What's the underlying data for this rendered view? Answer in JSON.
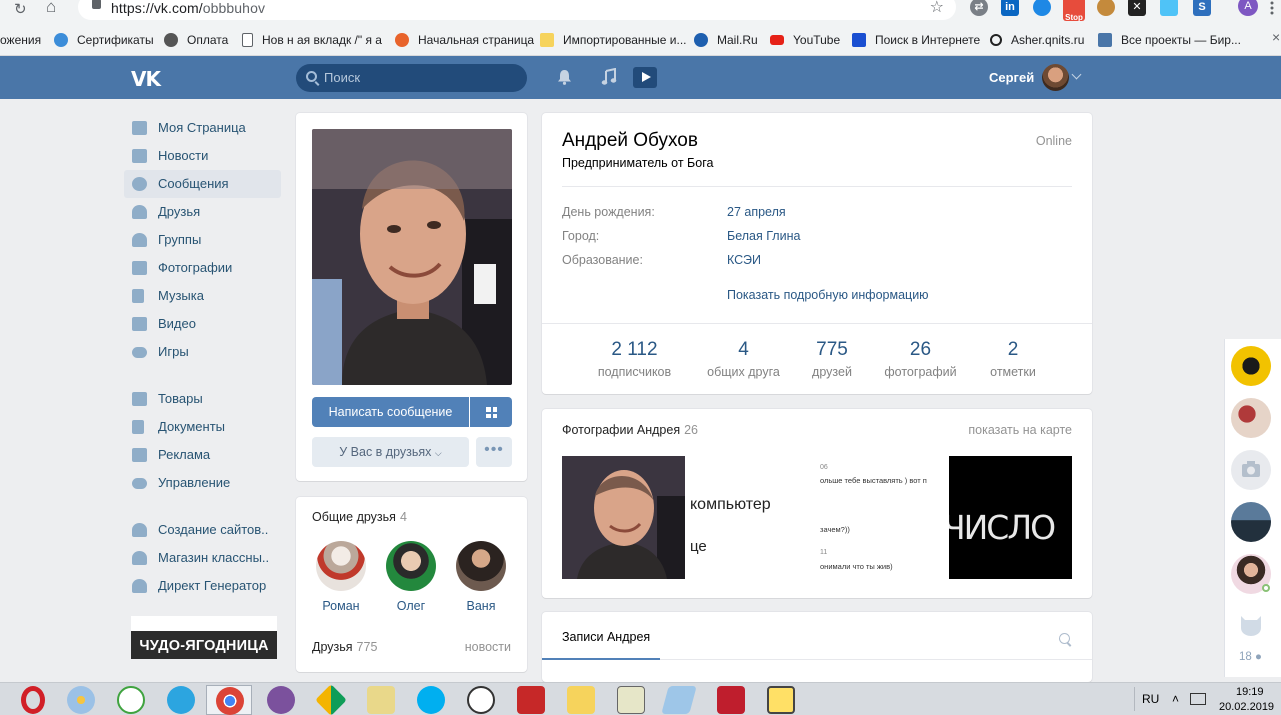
{
  "browser": {
    "url_host": "https://vk.com/",
    "url_path": "obbbuhov",
    "profile_letter": "A",
    "stop_ext_label": "Stop",
    "bookmarks": [
      {
        "label": "ожения",
        "icon": "apps-icon",
        "color": "#ffffff"
      },
      {
        "label": "Сертификаты",
        "icon": "glasses-icon",
        "color": "#3c8dd9"
      },
      {
        "label": "Оплата",
        "icon": "payment-icon",
        "color": "#555555"
      },
      {
        "label": "Нов н ая вкладк /\" я а",
        "icon": "page-icon",
        "color": "#ffffff"
      },
      {
        "label": "Начальная страница",
        "icon": "firefox-icon",
        "color": "#e8632b"
      },
      {
        "label": "Импортированные и...",
        "icon": "folder-icon",
        "color": "#f6d35c"
      },
      {
        "label": "Mail.Ru",
        "icon": "mailru-icon",
        "color": "#1e5faf"
      },
      {
        "label": "YouTube",
        "icon": "youtube-icon",
        "color": "#e62117"
      },
      {
        "label": "Поиск в Интернете",
        "icon": "search-web-icon",
        "color": "#1a4fd1"
      },
      {
        "label": "Asher.qnits.ru",
        "icon": "q-icon",
        "color": "#222222"
      },
      {
        "label": "Все проекты — Бир...",
        "icon": "cart-icon",
        "color": "#4a76a8"
      }
    ]
  },
  "header": {
    "search_placeholder": "Поиск",
    "user_name": "Сергей"
  },
  "nav": {
    "group1": [
      {
        "label": "Моя Страница",
        "active": false
      },
      {
        "label": "Новости",
        "active": false
      },
      {
        "label": "Сообщения",
        "active": true
      },
      {
        "label": "Друзья",
        "active": false
      },
      {
        "label": "Группы",
        "active": false
      },
      {
        "label": "Фотографии",
        "active": false
      },
      {
        "label": "Музыка",
        "active": false
      },
      {
        "label": "Видео",
        "active": false
      },
      {
        "label": "Игры",
        "active": false
      }
    ],
    "group2": [
      {
        "label": "Товары"
      },
      {
        "label": "Документы"
      },
      {
        "label": "Реклама"
      },
      {
        "label": "Управление"
      }
    ],
    "group3": [
      {
        "label": "Создание сайтов.."
      },
      {
        "label": "Магазин классны.."
      },
      {
        "label": "Директ Генератор"
      }
    ],
    "promo_text": "ЧУДО-ЯГОДНИЦА"
  },
  "profile": {
    "name": "Андрей Обухов",
    "status": "Предприниматель от Бога",
    "online": "Online",
    "write_button": "Написать сообщение",
    "friends_button": "У Вас в друзьях",
    "more_button": "•••",
    "info": [
      {
        "key": "День рождения:",
        "value": "27 апреля"
      },
      {
        "key": "Город:",
        "value": "Белая Глина"
      },
      {
        "key": "Образование:",
        "value": "КСЭИ"
      }
    ],
    "show_more": "Показать подробную информацию",
    "counters": [
      {
        "num": "2 112",
        "label": "подписчиков"
      },
      {
        "num": "4",
        "label": "общих друга"
      },
      {
        "num": "775",
        "label": "друзей"
      },
      {
        "num": "26",
        "label": "фотографий"
      },
      {
        "num": "2",
        "label": "отметки"
      }
    ]
  },
  "common_friends": {
    "title": "Общие друзья",
    "count": "4",
    "people": [
      "Роман",
      "Олег",
      "Ваня"
    ],
    "friends_title": "Друзья",
    "friends_count": "775",
    "news_link": "новости"
  },
  "photos": {
    "title": "Фотографии Андрея",
    "count": "26",
    "map_link": "показать на карте",
    "thumb2_lines": [
      "компьютер",
      "це"
    ],
    "thumb3_lines": [
      "06",
      "ольше тебе выставлять ) вот п",
      "зачем?))",
      "11",
      "онимали что ты жив)"
    ],
    "thumb4_text": "ЧИСЛО"
  },
  "wall": {
    "tab_label": "Записи Андрея"
  },
  "rail": {
    "count": "18"
  },
  "taskbar": {
    "lang": "RU",
    "time": "19:19",
    "date": "20.02.2019"
  }
}
